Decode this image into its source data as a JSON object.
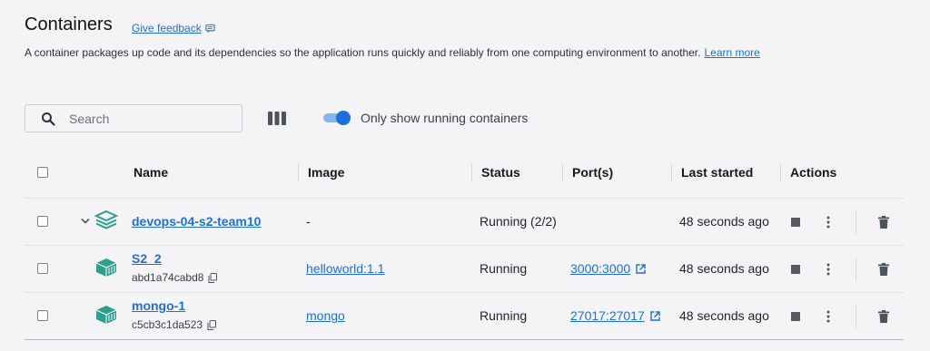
{
  "header": {
    "title": "Containers",
    "feedback_label": "Give feedback",
    "description": "A container packages up code and its dependencies so the application runs quickly and reliably from one computing environment to another.",
    "learn_more": "Learn more"
  },
  "toolbar": {
    "search_placeholder": "Search",
    "toggle_label": "Only show running containers",
    "toggle_on": true
  },
  "table": {
    "columns": {
      "name": "Name",
      "image": "Image",
      "status": "Status",
      "ports": "Port(s)",
      "last_started": "Last started",
      "actions": "Actions"
    },
    "rows": [
      {
        "name": "devops-04-s2-team10",
        "id": "",
        "image": "-",
        "status": "Running (2/2)",
        "ports": "",
        "last_started": "48 seconds ago",
        "type": "compose"
      },
      {
        "name": "S2_2",
        "id": "abd1a74cabd8",
        "image": "helloworld:1.1",
        "status": "Running",
        "ports": "3000:3000",
        "last_started": "48 seconds ago",
        "type": "container"
      },
      {
        "name": "mongo-1",
        "id": "c5cb3c1da523",
        "image": "mongo",
        "status": "Running",
        "ports": "27017:27017",
        "last_started": "48 seconds ago",
        "type": "container"
      }
    ]
  },
  "colors": {
    "accent": "#1f6fd6",
    "container_icon": "#2f9e8f"
  },
  "icons": [
    "feedback-icon",
    "search-icon",
    "columns-icon",
    "chevron-down-icon",
    "compose-stack-icon",
    "container-icon",
    "copy-icon",
    "external-link-icon",
    "stop-icon",
    "more-icon",
    "trash-icon"
  ]
}
